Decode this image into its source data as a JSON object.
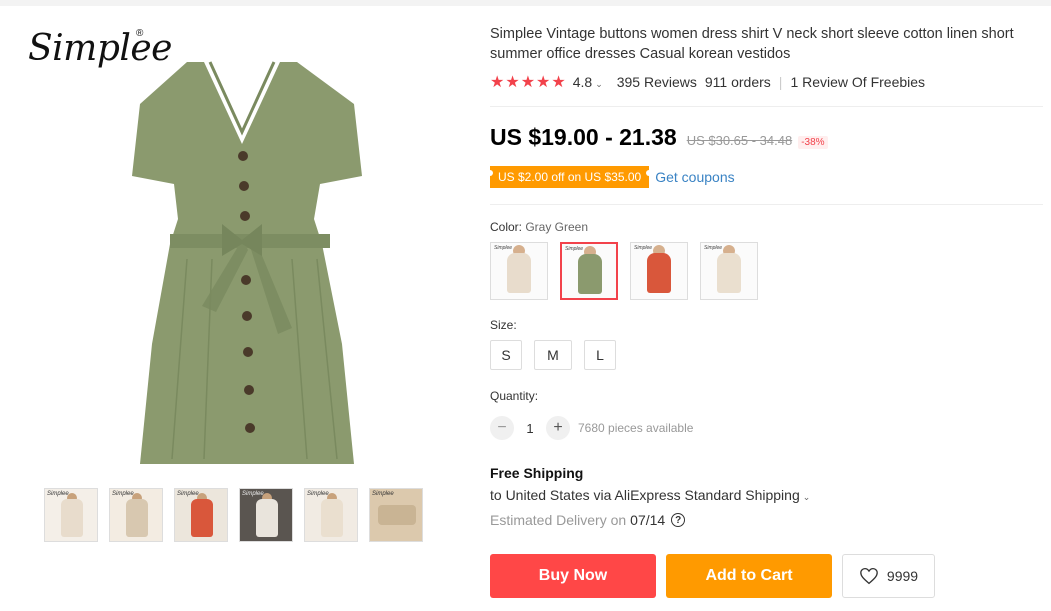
{
  "brand": {
    "logo_text": "Simplee",
    "reg_mark": "®"
  },
  "product": {
    "title": "Simplee Vintage buttons women dress shirt V neck short sleeve cotton linen short summer office dresses Casual korean vestidos",
    "rating": "4.8",
    "reviews": "395 Reviews",
    "orders": "911 orders",
    "freebies": "1 Review Of Freebies",
    "price": "US $19.00 - 21.38",
    "old_price": "US $30.65 - 34.48",
    "discount": "-38%",
    "coupon_text": "US $2.00 off on US $35.00",
    "get_coupons": "Get coupons"
  },
  "colors": {
    "label": "Color: ",
    "selected": "Gray Green",
    "options": [
      {
        "name": "Beige",
        "color": "#e8dccc"
      },
      {
        "name": "Gray Green",
        "color": "#8b9a6e"
      },
      {
        "name": "Orange",
        "color": "#d9573b"
      },
      {
        "name": "Apricot",
        "color": "#eadfcf"
      }
    ]
  },
  "sizes": {
    "label": "Size:",
    "options": [
      "S",
      "M",
      "L"
    ]
  },
  "quantity": {
    "label": "Quantity:",
    "minus": "−",
    "value": "1",
    "plus": "+",
    "available": "7680 pieces available"
  },
  "shipping": {
    "title": "Free Shipping",
    "destination": "to United States via AliExpress Standard Shipping",
    "delivery_label": "Estimated Delivery on",
    "delivery_date": "07/14",
    "help_icon": "?"
  },
  "actions": {
    "buy_now": "Buy Now",
    "add_to_cart": "Add to Cart",
    "wish_count": "9999"
  },
  "thumbnails": [
    {
      "color": "#e8dccc"
    },
    {
      "color": "#d8c8b0"
    },
    {
      "color": "#d9573b"
    },
    {
      "color": "#e9e4dc"
    },
    {
      "color": "#eadfcf"
    },
    {
      "color": "#dcc9ad"
    }
  ],
  "icons": {
    "star": "star-icon",
    "caret": "chevron-down-icon",
    "heart": "heart-icon",
    "help": "question-circle-icon"
  },
  "accent_colors": {
    "red": "#ff4747",
    "orange": "#ff9a00",
    "link": "#3a83c4",
    "dress_green": "#8b9a6e"
  }
}
